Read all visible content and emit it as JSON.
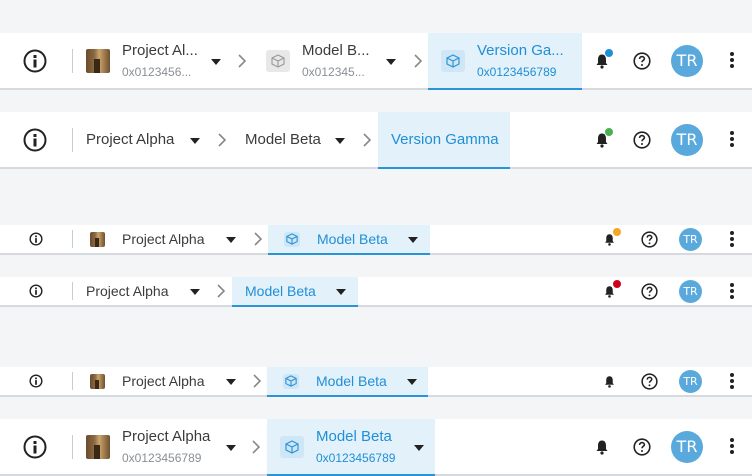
{
  "common": {
    "project_name": "Project Alpha",
    "project_name_truncated": "Project Al...",
    "model_name": "Model Beta",
    "model_name_truncated": "Model B...",
    "version_name": "Version Gamma",
    "version_name_truncated": "Version Ga...",
    "id_full": "0x0123456789",
    "id_trunc_1": "0x0123456...",
    "id_trunc_2": "0x012345...",
    "avatar_initials": "TR"
  },
  "colors": {
    "accent": "#2a95d6",
    "active_bg": "#e3f1fb",
    "avatar_bg": "#5aa9dd",
    "dot_blue": "#1f8fd6",
    "dot_green": "#4caf50",
    "dot_orange": "#f5a623",
    "dot_red": "#d0021b"
  },
  "icons": {
    "logo": "info-logo-icon",
    "separator": "chevron-right-icon",
    "dropdown": "caret-down-icon",
    "model": "cube-icon",
    "notifications": "bell-icon",
    "help": "help-circle-icon",
    "more": "more-vertical-icon"
  },
  "rows": [
    {
      "variant": "large-with-thumbnails-and-ids",
      "active_crumb": "version",
      "notification_dot": "blue"
    },
    {
      "variant": "large-text-only",
      "active_crumb": "version",
      "notification_dot": "green"
    },
    {
      "variant": "small-with-thumbnails",
      "active_crumb": "model",
      "notification_dot": "orange"
    },
    {
      "variant": "small-text-only",
      "active_crumb": "model",
      "notification_dot": "red"
    },
    {
      "variant": "small-with-thumbnails",
      "active_crumb": "model",
      "notification_dot": "none"
    },
    {
      "variant": "large-with-thumbnails-and-ids",
      "active_crumb": "model",
      "notification_dot": "none"
    }
  ]
}
